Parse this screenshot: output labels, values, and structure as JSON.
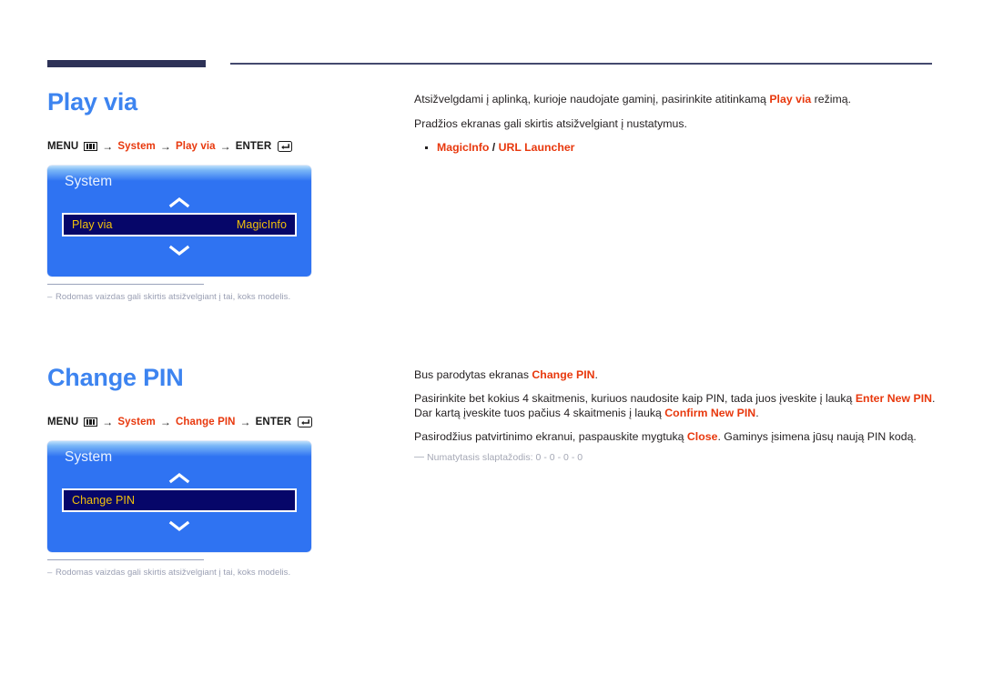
{
  "header": {
    "rule_accent_color": "#2e3257",
    "rule_line_color": "#44496e"
  },
  "colors": {
    "title_blue": "#3d84f0",
    "accent_red": "#e8380d",
    "osd_blue": "#2f73f2",
    "osd_row_navy": "#060669",
    "osd_row_text": "#f2c10a",
    "note_gray": "#9a9fb3"
  },
  "sections": [
    {
      "id": "play-via",
      "title": "Play via",
      "breadcrumb": {
        "menu_label": "MENU",
        "menu_icon": "menu-grid-icon",
        "arrow": "→",
        "path": [
          "System",
          "Play via"
        ],
        "enter_label": "ENTER",
        "enter_icon": "enter-return-icon"
      },
      "osd": {
        "panel_title": "System",
        "scroll_up_icon": "chevron-up-icon",
        "scroll_down_icon": "chevron-down-icon",
        "row_label": "Play via",
        "row_value": "MagicInfo"
      },
      "note": "Rodomas vaizdas gali skirtis atsižvelgiant į tai, koks modelis.",
      "note_dash": "–",
      "paragraphs": [
        [
          {
            "t": "Atsižvelgdami į aplinką, kurioje naudojate gaminį, pasirinkite atitinkamą ",
            "s": "plain"
          },
          {
            "t": "Play via",
            "s": "red"
          },
          {
            "t": " režimą.",
            "s": "plain"
          }
        ],
        [
          {
            "t": "Pradžios ekranas gali skirtis atsižvelgiant į nustatymus.",
            "s": "plain"
          }
        ]
      ],
      "bullets": [
        [
          {
            "t": "MagicInfo",
            "s": "red"
          },
          {
            "t": " / ",
            "s": "sep"
          },
          {
            "t": "URL Launcher",
            "s": "red"
          }
        ]
      ]
    },
    {
      "id": "change-pin",
      "title": "Change PIN",
      "breadcrumb": {
        "menu_label": "MENU",
        "menu_icon": "menu-grid-icon",
        "arrow": "→",
        "path": [
          "System",
          "Change PIN"
        ],
        "enter_label": "ENTER",
        "enter_icon": "enter-return-icon"
      },
      "osd": {
        "panel_title": "System",
        "scroll_up_icon": "chevron-up-icon",
        "scroll_down_icon": "chevron-down-icon",
        "row_label": "Change PIN",
        "row_value": ""
      },
      "note": "Rodomas vaizdas gali skirtis atsižvelgiant į tai, koks modelis.",
      "note_dash": "–",
      "paragraphs": [
        [
          {
            "t": "Bus parodytas ekranas ",
            "s": "plain"
          },
          {
            "t": "Change PIN",
            "s": "red"
          },
          {
            "t": ".",
            "s": "plain"
          }
        ],
        [
          {
            "t": "Pasirinkite bet kokius 4 skaitmenis, kuriuos naudosite kaip PIN, tada juos įveskite į lauką ",
            "s": "plain"
          },
          {
            "t": "Enter New PIN",
            "s": "red"
          },
          {
            "t": ". Dar kartą įveskite tuos pačius 4 skaitmenis į lauką ",
            "s": "plain"
          },
          {
            "t": "Confirm New PIN",
            "s": "red"
          },
          {
            "t": ".",
            "s": "plain"
          }
        ],
        [
          {
            "t": "Pasirodžius patvirtinimo ekranui, paspauskite mygtuką ",
            "s": "plain"
          },
          {
            "t": "Close",
            "s": "red"
          },
          {
            "t": ". Gaminys įsimena jūsų naują PIN kodą.",
            "s": "plain"
          }
        ]
      ],
      "bullets": [],
      "footnote": "Numatytasis slaptažodis: 0 - 0 - 0 - 0"
    }
  ]
}
